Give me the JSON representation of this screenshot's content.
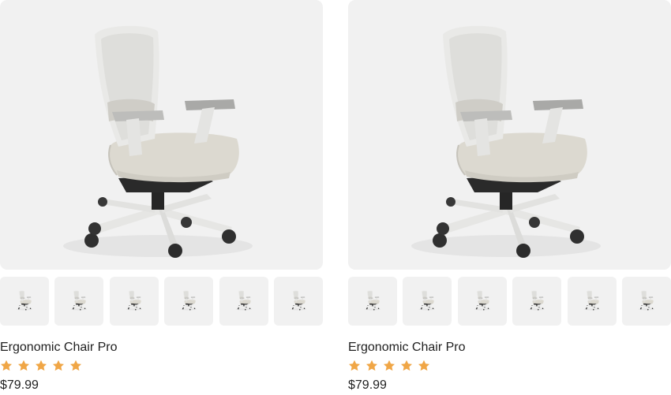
{
  "products": [
    {
      "name": "Ergonomic Chair Pro",
      "price": "$79.99",
      "rating": 5,
      "thumbnail_count": 6
    },
    {
      "name": "Ergonomic Chair Pro",
      "price": "$79.99",
      "rating": 5,
      "thumbnail_count": 6
    }
  ],
  "colors": {
    "image_background": "#f1f1f1",
    "star": "#f0a646",
    "text": "#1f1f1f"
  },
  "icons": {
    "rating": "star-icon",
    "product_image": "office-chair"
  }
}
